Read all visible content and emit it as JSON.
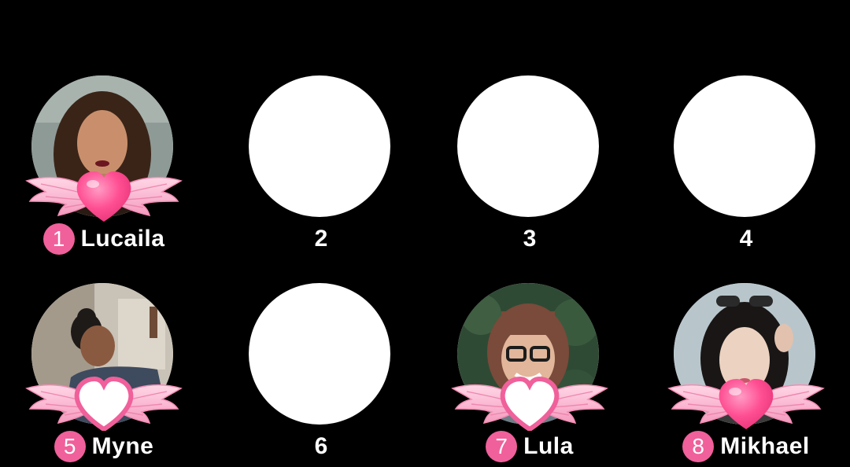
{
  "colors": {
    "background": "#000000",
    "accent_pink": "#f0609a",
    "empty_seat": "#ffffff"
  },
  "seats": [
    {
      "number": "1",
      "name": "Lucaila",
      "occupied": true,
      "heart": "filled-heart-icon"
    },
    {
      "number": "2",
      "name": "",
      "occupied": false
    },
    {
      "number": "3",
      "name": "",
      "occupied": false
    },
    {
      "number": "4",
      "name": "",
      "occupied": false
    },
    {
      "number": "5",
      "name": "Myne",
      "occupied": true,
      "heart": "outline-heart-icon"
    },
    {
      "number": "6",
      "name": "",
      "occupied": false
    },
    {
      "number": "7",
      "name": "Lula",
      "occupied": true,
      "heart": "outline-heart-icon"
    },
    {
      "number": "8",
      "name": "Mikhael",
      "occupied": true,
      "heart": "filled-heart-icon"
    }
  ]
}
